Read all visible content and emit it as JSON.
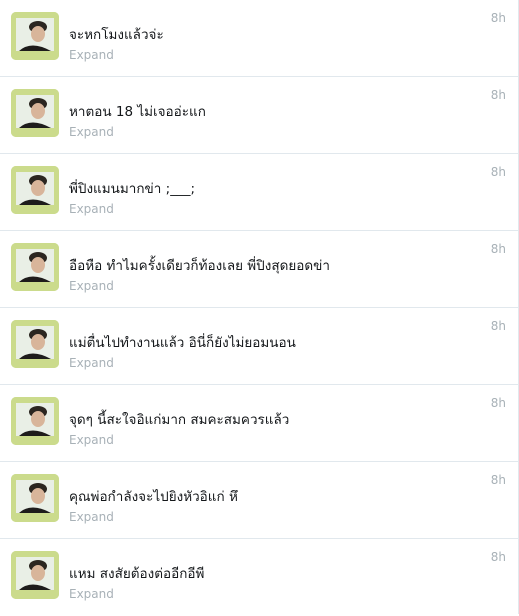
{
  "tweets": [
    {
      "avatar_icon": "user-photo-icon",
      "text": "จะหกโมงแล้วจ่ะ",
      "expand_label": "Expand",
      "time": "8h"
    },
    {
      "avatar_icon": "user-photo-icon",
      "text": "หาตอน 18 ไม่เจออ่ะแก",
      "expand_label": "Expand",
      "time": "8h"
    },
    {
      "avatar_icon": "user-photo-icon",
      "text": "พี่ปิงแมนมากข่า ;___;",
      "expand_label": "Expand",
      "time": "8h"
    },
    {
      "avatar_icon": "user-photo-icon",
      "text": "อือหือ ทำไมครั้งเดียวก็ท้องเลย พี่ปิงสุดยอดข่า",
      "expand_label": "Expand",
      "time": "8h"
    },
    {
      "avatar_icon": "user-photo-icon",
      "text": "แม่ตื่นไปทำงานแล้ว อินี่ก็ยังไม่ยอมนอน",
      "expand_label": "Expand",
      "time": "8h"
    },
    {
      "avatar_icon": "user-photo-icon",
      "text": "จุดๆ นี้สะใจอิแก่มาก สมคะสมควรแล้ว",
      "expand_label": "Expand",
      "time": "8h"
    },
    {
      "avatar_icon": "user-photo-icon",
      "text": "คุณพ่อกำลังจะไปยิงหัวอิแก่ หึ",
      "expand_label": "Expand",
      "time": "8h"
    },
    {
      "avatar_icon": "user-photo-icon",
      "text": "แหม สงสัยต้องต่ออีกอีพี",
      "expand_label": "Expand",
      "time": "8h"
    }
  ],
  "colors": {
    "border": "#e1e8ed",
    "muted": "#a8b1b7",
    "text": "#14171a",
    "avatar_bg": "#c9d98a"
  }
}
